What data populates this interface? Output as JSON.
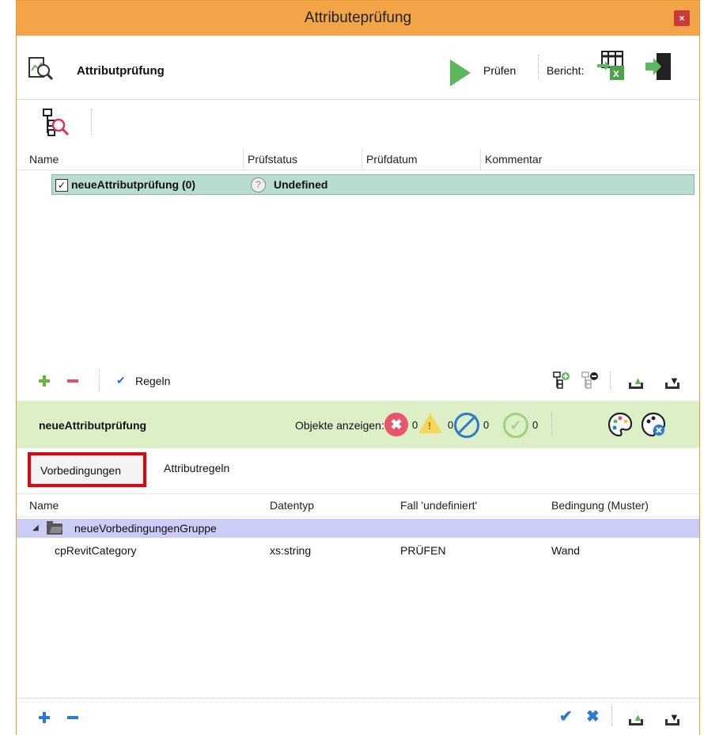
{
  "window": {
    "title": "Attributeprüfung",
    "close_label": "×"
  },
  "toolbar": {
    "app_label": "Attributprüfung",
    "run_label": "Prüfen",
    "report_label": "Bericht:"
  },
  "table1": {
    "headers": [
      "Name",
      "Prüfstatus",
      "Prüfdatum",
      "Kommentar"
    ],
    "rows": [
      {
        "checked": "✓",
        "name": "neueAttributprüfung (0)",
        "status": "Undefined",
        "status_icon": "?"
      }
    ]
  },
  "panel1_bottom": {
    "rules_label": "Regeln"
  },
  "section": {
    "title": "neueAttributprüfung",
    "show_objects_label": "Objekte anzeigen:",
    "counts": {
      "error": "0",
      "warning": "0",
      "ignored": "0",
      "ok": "0"
    }
  },
  "tabs": {
    "active": "Vorbedingungen",
    "other": "Attributregeln"
  },
  "table2": {
    "headers": [
      "Name",
      "Datentyp",
      "Fall 'undefiniert'",
      "Bedingung (Muster)"
    ],
    "group": "neueVorbedingungenGruppe",
    "rows": [
      {
        "name": "cpRevitCategory",
        "type": "xs:string",
        "case": "PRÜFEN",
        "condition": "Wand"
      }
    ]
  },
  "colors": {
    "accent": "#f2a446",
    "selection": "#b8dccd",
    "section_bg": "#dcefc7",
    "group_bg": "#cccdf7",
    "tab_highlight": "#e8000b"
  }
}
